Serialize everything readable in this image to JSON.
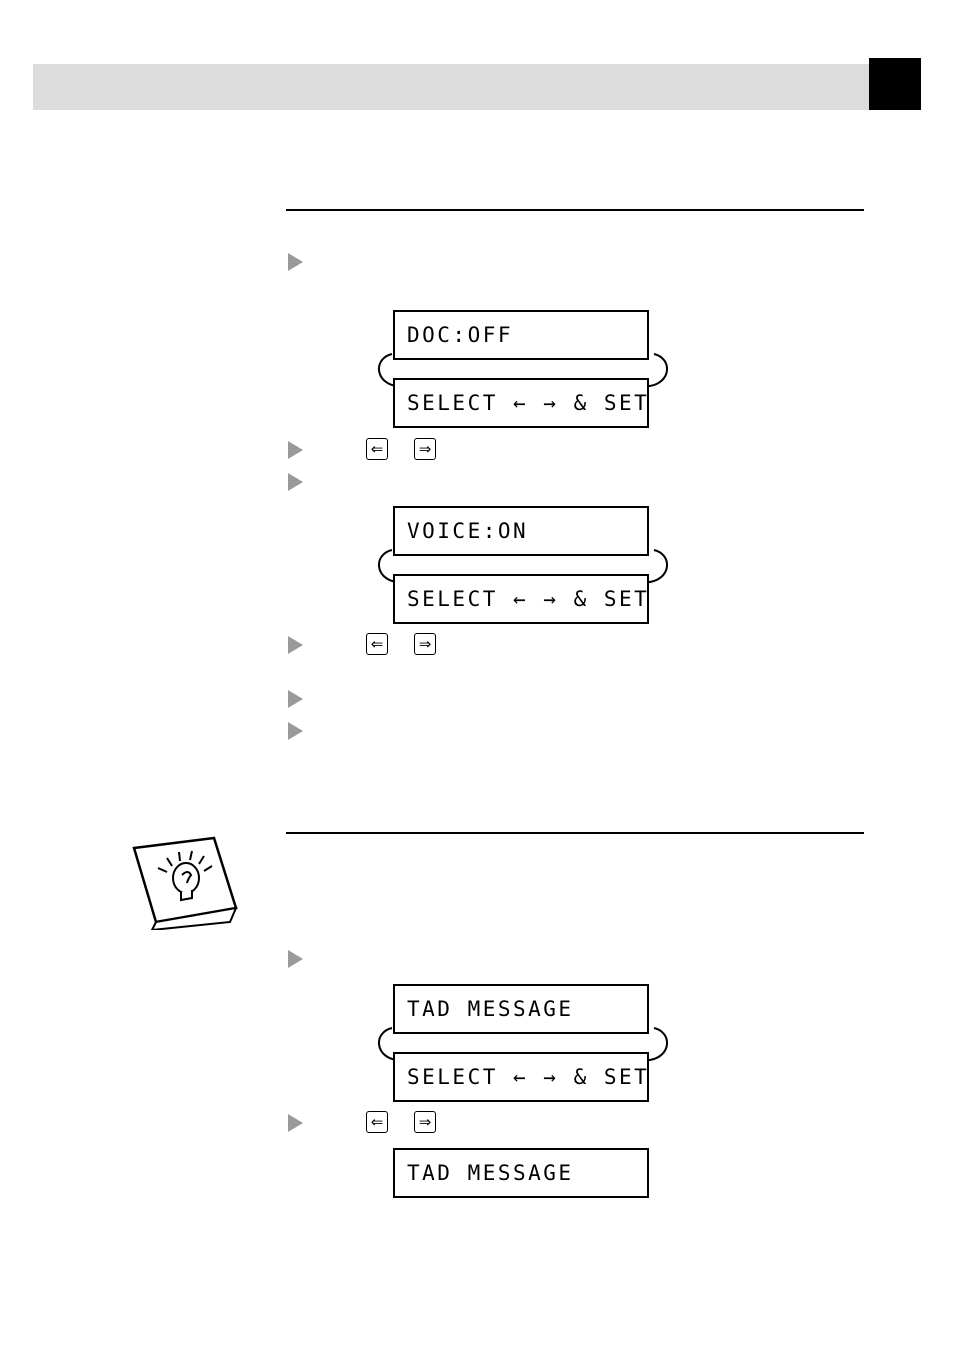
{
  "page": {
    "header": {
      "band_color": "#dcdcdc",
      "tab_color": "#000000",
      "band_text": "",
      "tab_text": ""
    },
    "rules": [
      {
        "name": "rule-top"
      },
      {
        "name": "rule-middle"
      }
    ],
    "sections": [
      {
        "name": "section-one",
        "steps": [
          {
            "name": "step-1",
            "text": ""
          },
          {
            "name": "step-2",
            "text": ""
          },
          {
            "name": "step-3",
            "text": ""
          },
          {
            "name": "step-4",
            "text": ""
          },
          {
            "name": "step-5",
            "text": ""
          },
          {
            "name": "step-6",
            "text": ""
          }
        ],
        "displays": [
          {
            "name": "lcd-doc-off",
            "line": "DOC:OFF"
          },
          {
            "name": "lcd-select-set-1",
            "line": "SELECT ← → & SET"
          },
          {
            "name": "lcd-voice-on",
            "line": "VOICE:ON"
          },
          {
            "name": "lcd-select-set-2",
            "line": "SELECT ← → & SET"
          }
        ],
        "keys": [
          {
            "name": "key-left-1",
            "glyph": "⇐"
          },
          {
            "name": "key-right-1",
            "glyph": "⇒"
          },
          {
            "name": "key-left-2",
            "glyph": "⇐"
          },
          {
            "name": "key-right-2",
            "glyph": "⇒"
          }
        ]
      },
      {
        "name": "section-two",
        "steps": [
          {
            "name": "step-7",
            "text": ""
          },
          {
            "name": "step-8",
            "text": ""
          }
        ],
        "displays": [
          {
            "name": "lcd-tad-message-1",
            "line": "TAD MESSAGE"
          },
          {
            "name": "lcd-select-set-3",
            "line": "SELECT ← → & SET"
          },
          {
            "name": "lcd-tad-message-2",
            "line": "TAD MESSAGE"
          }
        ],
        "keys": [
          {
            "name": "key-left-3",
            "glyph": "⇐"
          },
          {
            "name": "key-right-3",
            "glyph": "⇒"
          }
        ]
      }
    ],
    "note": {
      "name": "tip-lightbulb-note",
      "label": ""
    }
  }
}
